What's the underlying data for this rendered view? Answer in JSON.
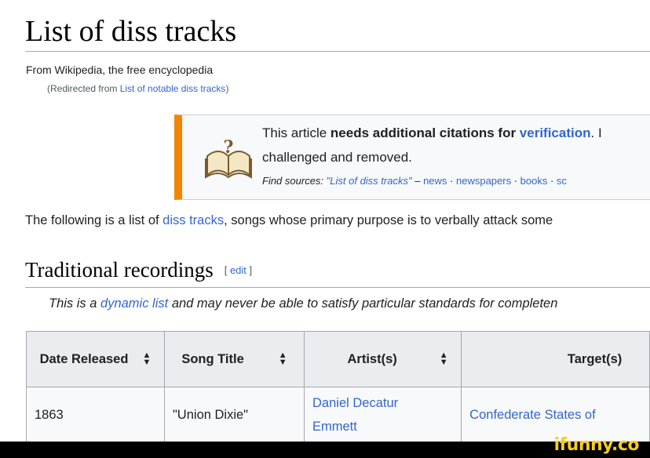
{
  "page": {
    "title": "List of diss tracks",
    "tagline": "From Wikipedia, the free encyclopedia",
    "redirect_prefix": "(Redirected from ",
    "redirect_link": "List of notable diss tracks",
    "redirect_suffix": ")"
  },
  "ambox": {
    "icon": "book-question-icon",
    "accent_color": "#f28500",
    "line1_prefix": "This article ",
    "line1_bold": "needs additional citations for ",
    "line1_link": "verification",
    "line1_suffix": ". I",
    "line2": "challenged and removed.",
    "find_label": "Find sources: ",
    "find_query": "\"List of diss tracks\"",
    "find_dash": " – ",
    "find_links": [
      "news",
      "newspapers",
      "books",
      "sc"
    ],
    "find_sep": " · "
  },
  "intro": {
    "prefix": "The following is a list of ",
    "link": "diss tracks",
    "suffix": ", songs whose primary purpose is to verbally attack some"
  },
  "section": {
    "heading": "Traditional recordings",
    "edit_open": "[ ",
    "edit_label": "edit",
    "edit_close": " ]"
  },
  "hatnote": {
    "prefix": "This is a ",
    "link": "dynamic list",
    "suffix": " and may never be able to satisfy particular standards for completen"
  },
  "table": {
    "headers": [
      "Date Released",
      "Song Title",
      "Artist(s)",
      "Target(s)"
    ],
    "rows": [
      {
        "date": "1863",
        "song": "\"Union Dixie\"",
        "artist": "Daniel Decatur Emmett",
        "target": "Confederate States of"
      }
    ]
  },
  "watermark": {
    "text": "ifunny.co",
    "color": "#f7cd1c"
  }
}
